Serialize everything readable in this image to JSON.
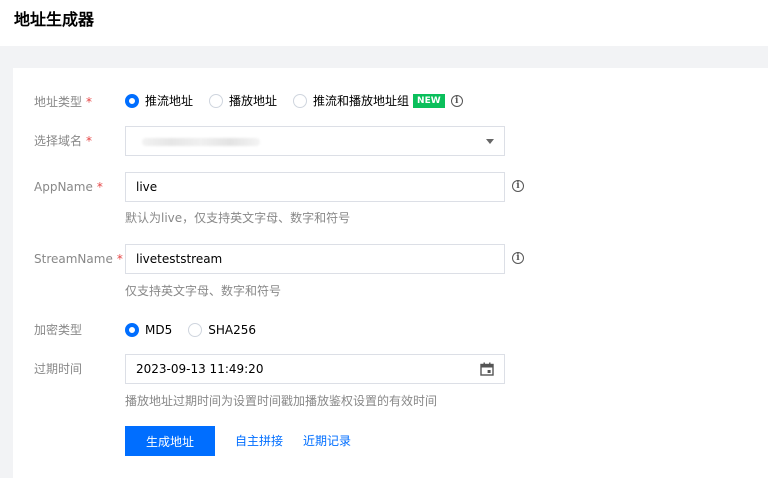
{
  "page": {
    "title": "地址生成器"
  },
  "form": {
    "address_type": {
      "label": "地址类型",
      "required": "*",
      "options": [
        {
          "label": "推流地址",
          "checked": true
        },
        {
          "label": "播放地址",
          "checked": false
        },
        {
          "label": "推流和播放地址组",
          "checked": false
        }
      ],
      "badge": "NEW"
    },
    "domain": {
      "label": "选择域名",
      "required": "*"
    },
    "appname": {
      "label": "AppName",
      "required": "*",
      "value": "live",
      "hint": "默认为live，仅支持英文字母、数字和符号"
    },
    "streamname": {
      "label": "StreamName",
      "required": "*",
      "value": "liveteststream",
      "hint": "仅支持英文字母、数字和符号"
    },
    "encryption": {
      "label": "加密类型",
      "options": [
        {
          "label": "MD5",
          "checked": true
        },
        {
          "label": "SHA256",
          "checked": false
        }
      ]
    },
    "expiry": {
      "label": "过期时间",
      "value": "2023-09-13 11:49:20",
      "hint": "播放地址过期时间为设置时间戳加播放鉴权设置的有效时间"
    }
  },
  "actions": {
    "generate": "生成地址",
    "custom_concat": "自主拼接",
    "recent_records": "近期记录"
  },
  "colors": {
    "primary": "#006eff",
    "required": "#e54545",
    "badge": "#0abf5b"
  }
}
